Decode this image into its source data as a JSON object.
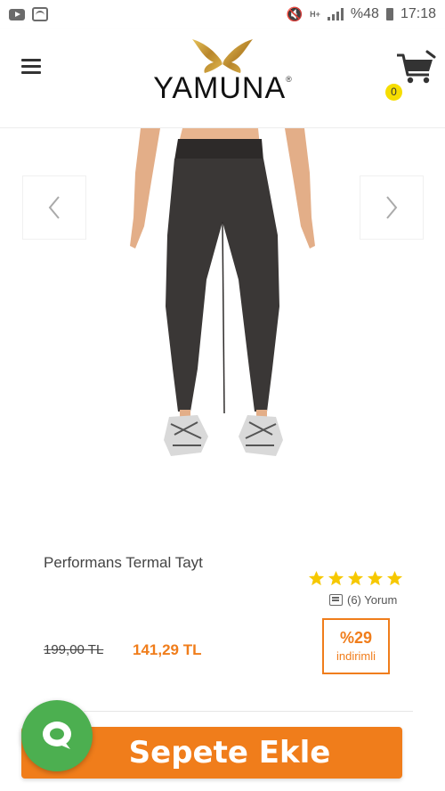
{
  "status_bar": {
    "battery_percent": "%48",
    "time": "17:18",
    "network": "H+"
  },
  "header": {
    "brand_name": "YAMUNA",
    "brand_reg": "®",
    "cart_count": "0"
  },
  "product": {
    "title": "Performans Termal Tayt",
    "rating_stars": 5,
    "reviews_label": "(6) Yorum",
    "old_price": "199,00 TL",
    "new_price": "141,29 TL",
    "discount_percent": "%29",
    "discount_label": "indirimli"
  },
  "actions": {
    "add_to_cart_label": "Sepete Ekle"
  },
  "colors": {
    "accent": "#f07d1b",
    "star": "#f6c800",
    "badge": "#f6dd00",
    "chat": "#4caf50"
  }
}
